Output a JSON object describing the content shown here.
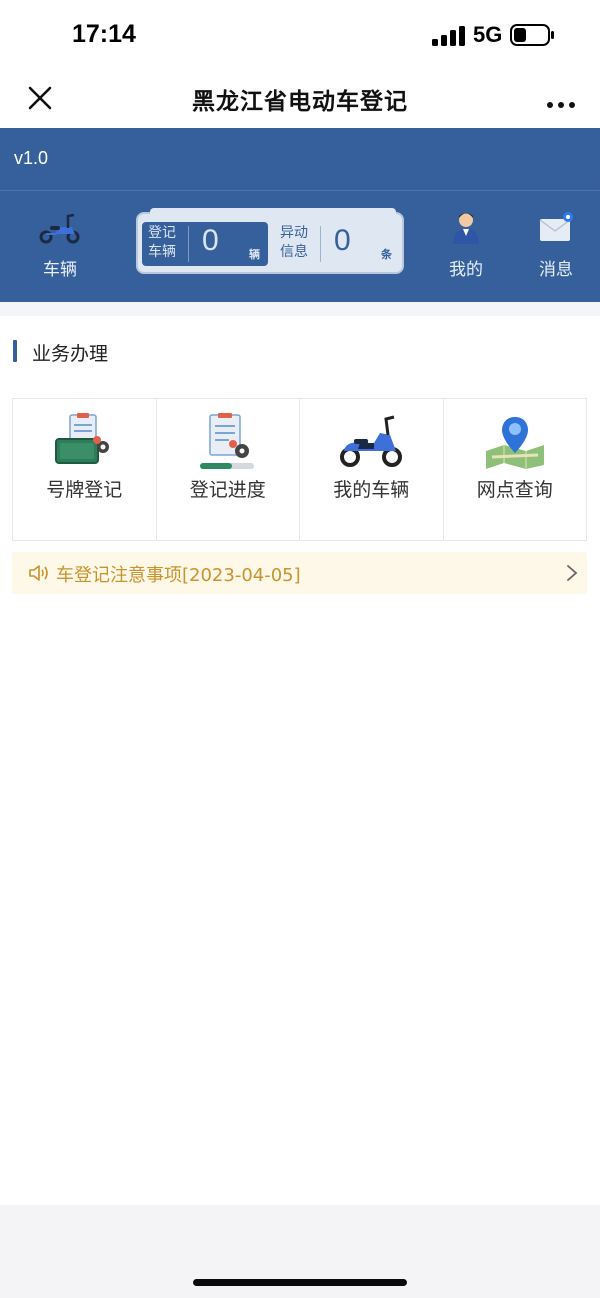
{
  "status_bar": {
    "time": "17:14",
    "network": "5G",
    "icons": [
      "signal-bars-icon",
      "battery-icon"
    ]
  },
  "nav": {
    "title": "黑龙江省电动车登记",
    "close_icon": "close-icon",
    "more_icon": "more-icon"
  },
  "header": {
    "version": "v1.0",
    "vehicle_label": "车辆",
    "stats": {
      "registered_label_line1": "登记",
      "registered_label_line2": "车辆",
      "registered_count": "0",
      "registered_unit": "辆",
      "anomaly_label_line1": "异动",
      "anomaly_label_line2": "信息",
      "anomaly_count": "0",
      "anomaly_unit": "条"
    },
    "mine_label": "我的",
    "message_label": "消息",
    "colors": {
      "primary": "#36609b",
      "panel": "#dfe7f2"
    }
  },
  "section": {
    "title": "业务办理"
  },
  "services": [
    {
      "label": "号牌登记",
      "icon": "plate-registration-icon"
    },
    {
      "label": "登记进度",
      "icon": "registration-progress-icon"
    },
    {
      "label": "我的车辆",
      "icon": "my-vehicle-icon"
    },
    {
      "label": "网点查询",
      "icon": "map-location-icon"
    }
  ],
  "notice": {
    "text": "车登记注意事项[2023-04-05]",
    "color": "#c9932e",
    "icon": "speaker-icon"
  }
}
